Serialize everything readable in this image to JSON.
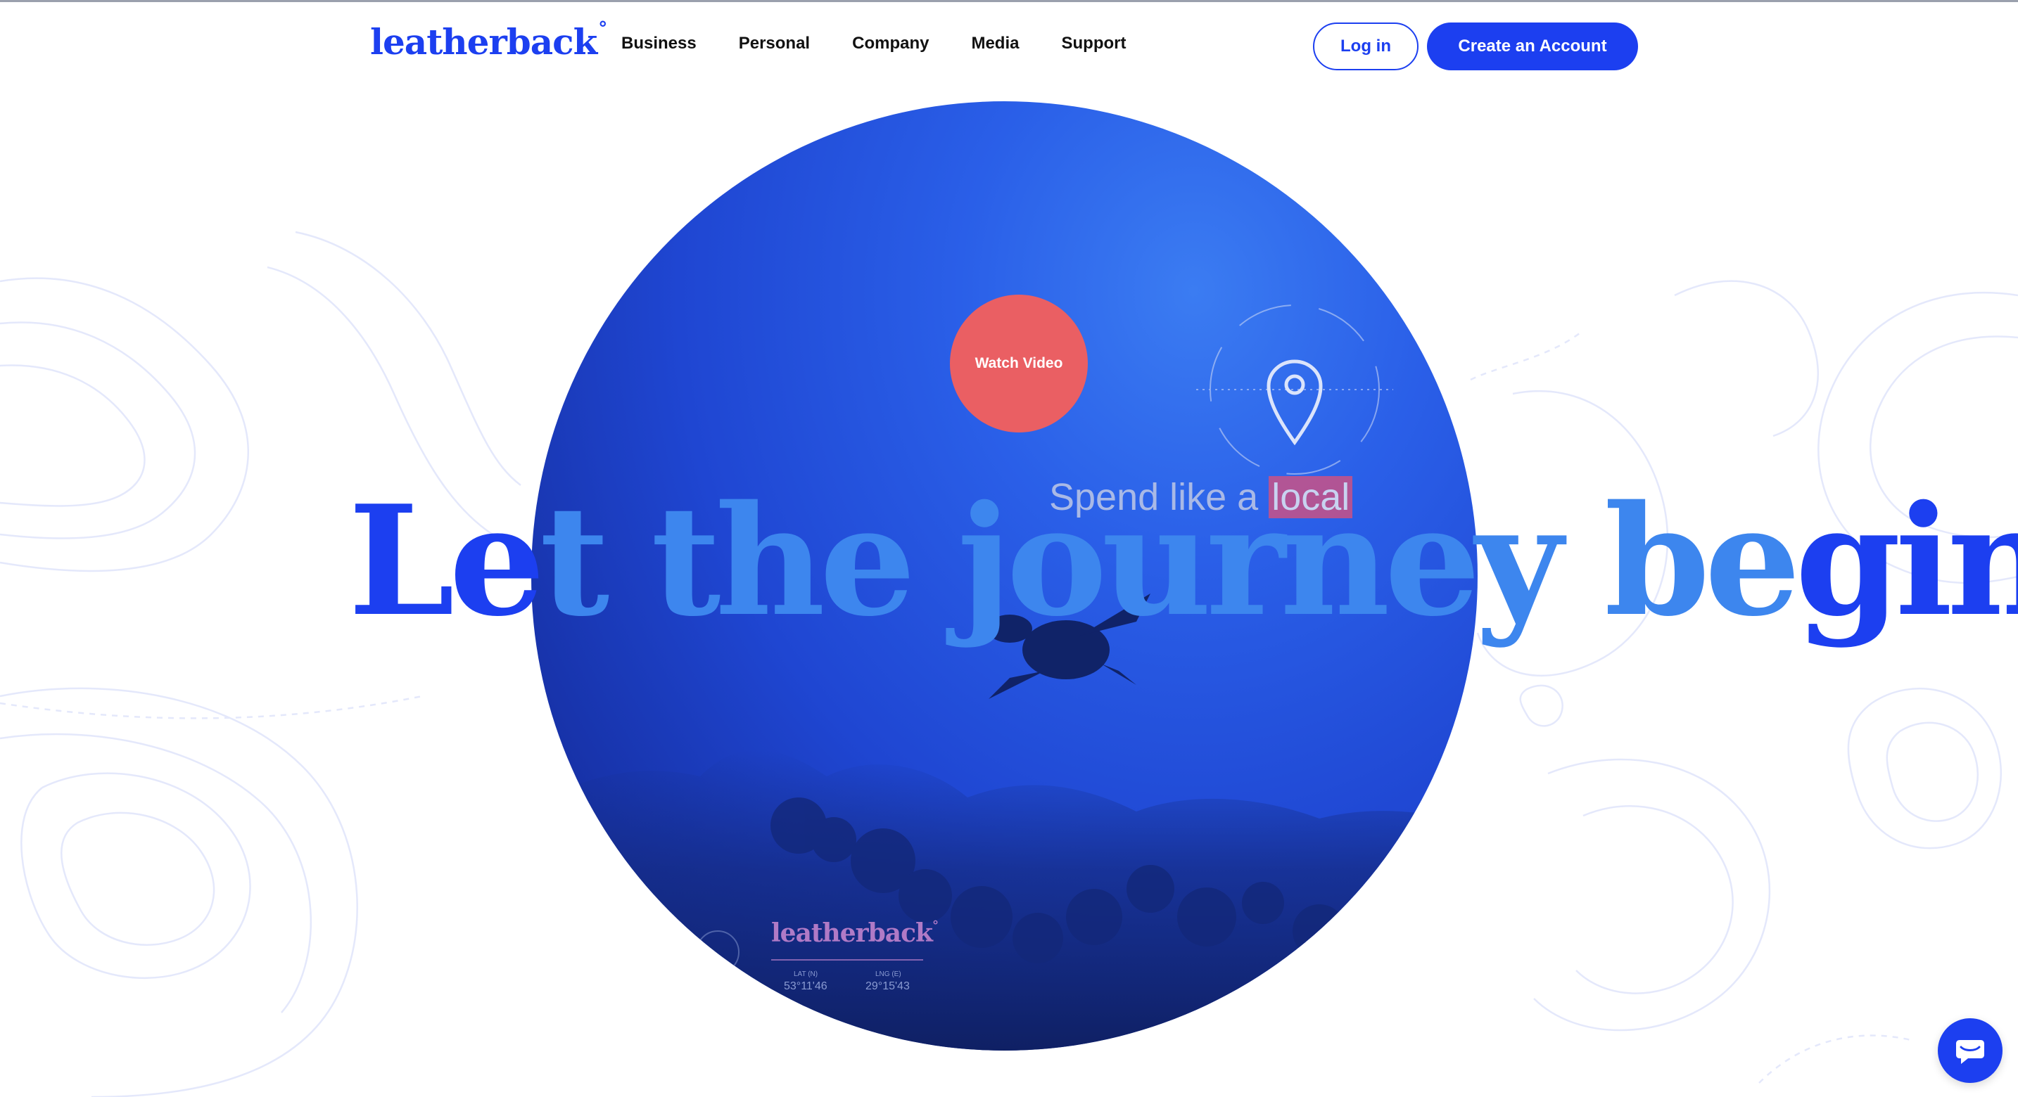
{
  "brand": {
    "logo_text": "leatherback",
    "logo_degree": "°",
    "primary_color": "#1c3ff0",
    "accent_color": "#ea5f63"
  },
  "nav": {
    "items": [
      "Business",
      "Personal",
      "Company",
      "Media",
      "Support"
    ]
  },
  "header": {
    "login_label": "Log in",
    "create_account_label": "Create an Account"
  },
  "hero": {
    "headline_outside_left": "Le",
    "headline_inside": "t the journey be",
    "headline_outside_right": "gin",
    "watch_video_label": "Watch Video",
    "video_overlay": {
      "spend_prefix": "Spend like a ",
      "spend_highlight": "local",
      "logo_text": "leatherback",
      "logo_degree": "°",
      "lat_label": "LAT (N)",
      "lat_value": "53°11'46",
      "lng_label": "LNG (E)",
      "lng_value": "29°15'43",
      "location_icon": "location-pin-icon"
    }
  },
  "chat": {
    "icon": "chat-bubble-icon"
  }
}
